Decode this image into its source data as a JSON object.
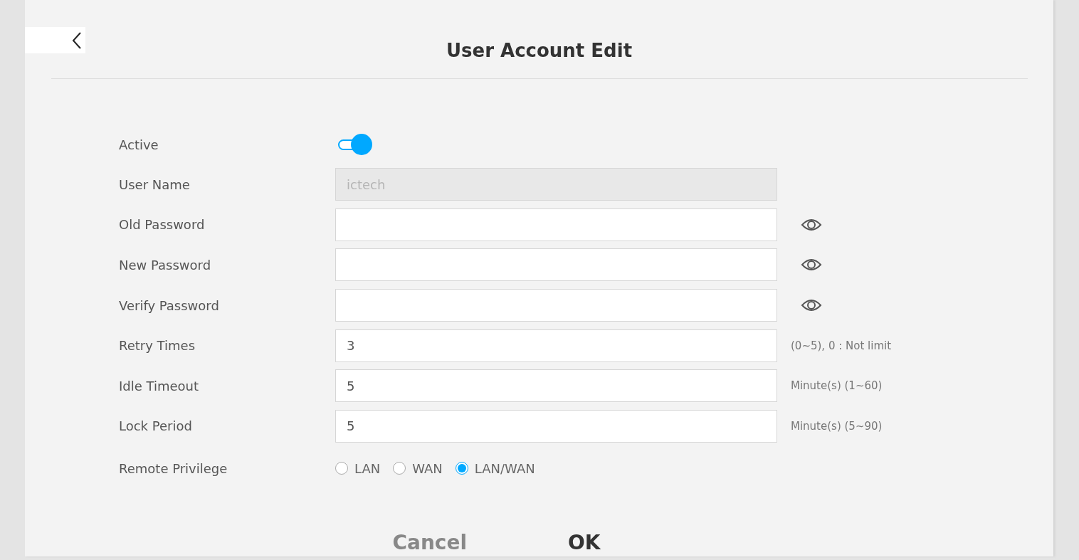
{
  "title": "User Account Edit",
  "fields": [
    {
      "kind": "toggle",
      "label": "Active",
      "on": true
    },
    {
      "kind": "text",
      "label": "User Name",
      "value": "ictech",
      "disabled": true
    },
    {
      "kind": "password",
      "label": "Old Password"
    },
    {
      "kind": "password",
      "label": "New Password"
    },
    {
      "kind": "password",
      "label": "Verify Password"
    },
    {
      "kind": "text",
      "label": "Retry Times",
      "value": "3",
      "disabled": false,
      "hint": "(0~5), 0 : Not limit"
    },
    {
      "kind": "text",
      "label": "Idle Timeout",
      "value": "5",
      "disabled": false,
      "hint": "Minute(s) (1~60)"
    },
    {
      "kind": "text",
      "label": "Lock Period",
      "value": "5",
      "disabled": false,
      "hint": "Minute(s) (5~90)"
    },
    {
      "kind": "radio",
      "label": "Remote Privilege",
      "options": [
        {
          "label": "LAN",
          "selected": false
        },
        {
          "label": "WAN",
          "selected": false
        },
        {
          "label": "LAN/WAN",
          "selected": true
        }
      ]
    }
  ],
  "buttons": [
    {
      "kind": "cancel",
      "label": "Cancel"
    },
    {
      "kind": "ok",
      "label": "OK"
    }
  ]
}
